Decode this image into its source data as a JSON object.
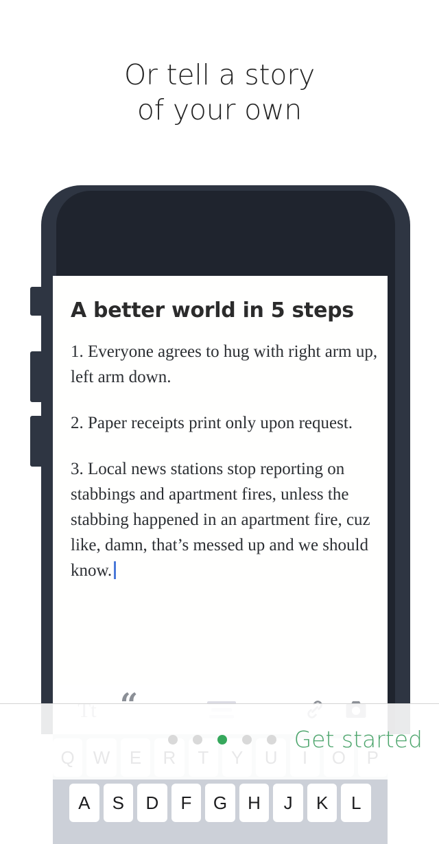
{
  "headline": {
    "line1": "Or tell a story",
    "line2": "of your own"
  },
  "device": {
    "camera_icon": "camera-dot",
    "speaker_icon": "speaker-grille"
  },
  "editor": {
    "document": {
      "title": "A better world in 5 steps",
      "paragraphs": [
        "1. Everyone agrees to hug with right arm up, left arm down.",
        "2. Paper receipts print only upon request.",
        "3. Local news stations stop reporting on stabbings and apartment fires, unless the stabbing happened in an apartment fire, cuz like, damn, that’s messed up and we should know."
      ],
      "caret_color": "#4a78d8"
    },
    "toolbar": {
      "typography_label": "Tt",
      "quote_label": "“",
      "items": [
        {
          "name": "typography",
          "icon": "text-format-icon",
          "enabled": true
        },
        {
          "name": "quote",
          "icon": "blockquote-icon",
          "enabled": true
        },
        {
          "name": "align-center",
          "icon": "align-center-icon",
          "enabled": false
        },
        {
          "name": "link",
          "icon": "link-icon",
          "enabled": true
        },
        {
          "name": "photo",
          "icon": "camera-icon",
          "enabled": true
        }
      ]
    }
  },
  "keyboard": {
    "row1": [
      "Q",
      "W",
      "E",
      "R",
      "T",
      "Y",
      "U",
      "I",
      "O",
      "P"
    ],
    "row2": [
      "A",
      "S",
      "D",
      "F",
      "G",
      "H",
      "J",
      "K",
      "L"
    ]
  },
  "footer": {
    "cta_label": "Get started",
    "cta_color": "#4ba46b",
    "pager": {
      "total": 5,
      "active_index": 3,
      "active_color": "#36a85c",
      "inactive_color": "#d9d9d9"
    }
  }
}
